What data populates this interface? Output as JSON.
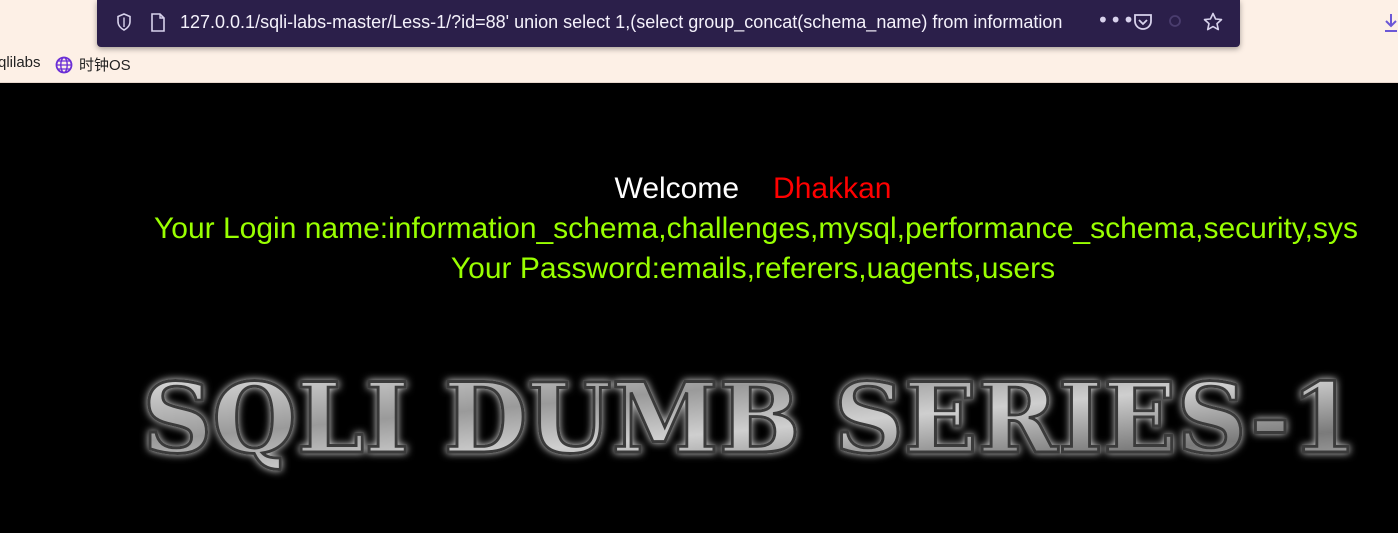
{
  "browser": {
    "url": "127.0.0.1/sqli-labs-master/Less-1/?id=88' union select 1,(select group_concat(schema_name) from information",
    "more_label": "•••",
    "bookmarks": [
      {
        "label": "qlilabs"
      },
      {
        "label": "时钟OS"
      }
    ]
  },
  "page": {
    "welcome": "Welcome",
    "user_name": "Dhakkan",
    "login_line": "Your Login name:information_schema,challenges,mysql,performance_schema,security,sys",
    "password_line": "Your Password:emails,referers,uagents,users",
    "banner_text": "SQLI DUMB SERIES-1"
  },
  "colors": {
    "background": "#000000",
    "welcome": "#ffffff",
    "user_name": "#ff0000",
    "result_text": "#99ff00",
    "urlbar": "#2b1f4a"
  }
}
